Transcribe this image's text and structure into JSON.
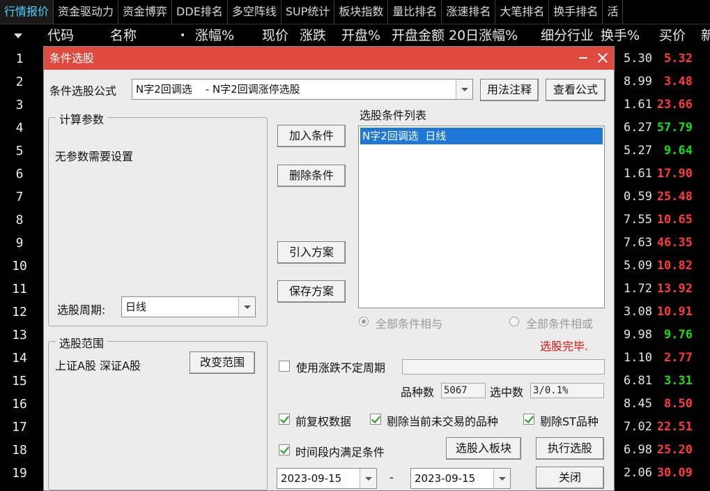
{
  "tabs": [
    "行情报价",
    "资金驱动力",
    "资金博弈",
    "DDE排名",
    "多空阵线",
    "SUP统计",
    "板块指数",
    "量比排名",
    "涨速排名",
    "大笔排名",
    "换手排名",
    "活"
  ],
  "columns": [
    "代码",
    "名称",
    "•",
    "涨幅%",
    "现价",
    "涨跌",
    "开盘%",
    "开盘金额",
    "20日涨幅%",
    "细分行业",
    "换手%",
    "买价",
    "新"
  ],
  "rows": [
    {
      "num": "1",
      "price": "5.30",
      "pct": "5.32",
      "color": "red"
    },
    {
      "num": "2",
      "price": "8.99",
      "pct": "3.48",
      "color": "red"
    },
    {
      "num": "3",
      "price": "1.61",
      "pct": "23.66",
      "color": "red"
    },
    {
      "num": "4",
      "price": "6.27",
      "pct": "57.79",
      "color": "green"
    },
    {
      "num": "5",
      "price": "5.27",
      "pct": "9.64",
      "color": "green"
    },
    {
      "num": "6",
      "price": "1.61",
      "pct": "17.90",
      "color": "red"
    },
    {
      "num": "7",
      "price": "0.59",
      "pct": "25.48",
      "color": "red"
    },
    {
      "num": "8",
      "price": "7.55",
      "pct": "10.65",
      "color": "red"
    },
    {
      "num": "9",
      "price": "7.63",
      "pct": "46.35",
      "color": "red"
    },
    {
      "num": "10",
      "price": "5.09",
      "pct": "10.82",
      "color": "red"
    },
    {
      "num": "11",
      "price": "1.72",
      "pct": "13.92",
      "color": "red"
    },
    {
      "num": "12",
      "price": "3.08",
      "pct": "10.91",
      "color": "red"
    },
    {
      "num": "13",
      "price": "9.98",
      "pct": "9.76",
      "color": "green"
    },
    {
      "num": "14",
      "price": "1.10",
      "pct": "2.77",
      "color": "red"
    },
    {
      "num": "15",
      "price": "6.81",
      "pct": "3.31",
      "color": "green"
    },
    {
      "num": "16",
      "price": "8.45",
      "pct": "8.50",
      "color": "red"
    },
    {
      "num": "17",
      "price": "7.02",
      "pct": "22.51",
      "color": "red"
    },
    {
      "num": "18",
      "price": "6.98",
      "pct": "25.20",
      "color": "red"
    },
    {
      "num": "19",
      "price": "2.06",
      "pct": "30.09",
      "color": "red"
    }
  ],
  "dialog": {
    "title": "条件选股",
    "formula_label": "条件选股公式",
    "formula_value": "N字2回调选    - N字2回调涨停选股",
    "usage_button": "用法注释",
    "view_button": "查看公式",
    "params_group": "计算参数",
    "params_text": "无参数需要设置",
    "period_label": "选股周期:",
    "period_value": "日线",
    "range_group": "选股范围",
    "range_text": "上证A股 深证A股",
    "change_range_button": "改变范围",
    "add_button": "加入条件",
    "delete_button": "删除条件",
    "import_button": "引入方案",
    "save_button": "保存方案",
    "cond_list_label": "选股条件列表",
    "cond_item": "N字2回调选  日线",
    "radio_and": "全部条件相与",
    "radio_or": "全部条件相或",
    "status": "选股完毕.",
    "use_period_label": "使用涨跌不定周期",
    "count_label": "品种数",
    "count_value": "5067",
    "selected_label": "选中数",
    "selected_value": "3/0.1%",
    "chk_fq": "前复权数据",
    "chk_notrade": "剔除当前未交易的品种",
    "chk_st": "剔除ST品种",
    "chk_timespan": "时间段内满足条件",
    "to_block_button": "选股入板块",
    "exec_button": "执行选股",
    "date_start": "2023-09-15",
    "date_sep": "-",
    "date_end": "2023-09-15",
    "close_button": "关闭"
  },
  "colors": {
    "accent_title": "#e04a3e",
    "up": "#ff3a3a",
    "down": "#14e014",
    "selection": "#1e78d8"
  }
}
